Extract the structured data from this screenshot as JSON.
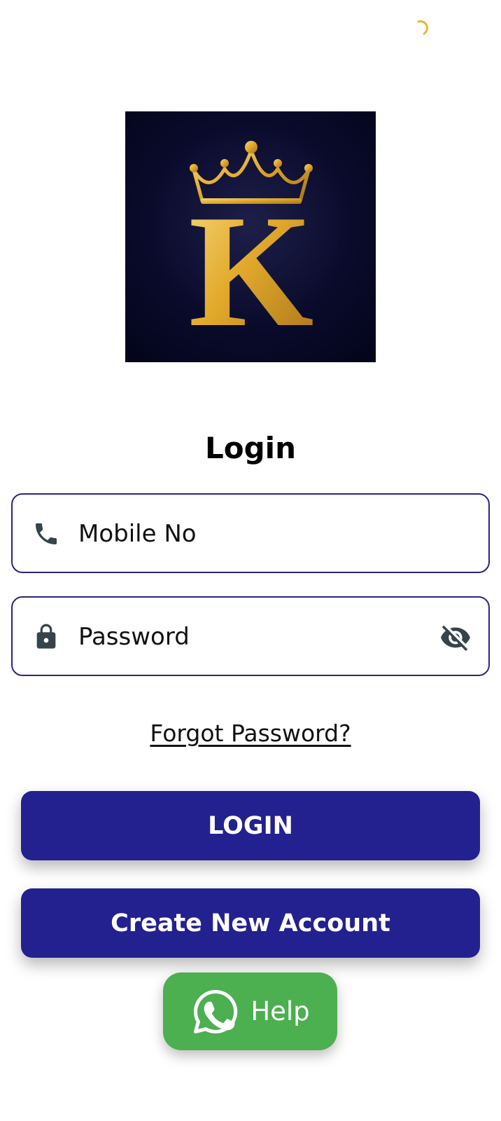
{
  "screen": {
    "title": "Login"
  },
  "logo": {
    "letter": "K",
    "description_icon": "crown-k-logo"
  },
  "mobile_field": {
    "placeholder": "Mobile No",
    "icon": "phone-icon"
  },
  "password_field": {
    "placeholder": "Password",
    "icon": "lock-icon",
    "toggle_icon": "eye-off-icon"
  },
  "forgot_password": {
    "label": "Forgot Password?"
  },
  "buttons": {
    "login_label": "LOGIN",
    "create_label": "Create New Account"
  },
  "help_button": {
    "label": "Help",
    "icon": "whatsapp-icon"
  },
  "colors": {
    "primary": "#23218f",
    "field_border": "#2a2580",
    "help_green": "#4caf50",
    "spinner": "#e8b92a",
    "logo_bg": "#0a0b2b",
    "gold": "#e5b53a"
  }
}
